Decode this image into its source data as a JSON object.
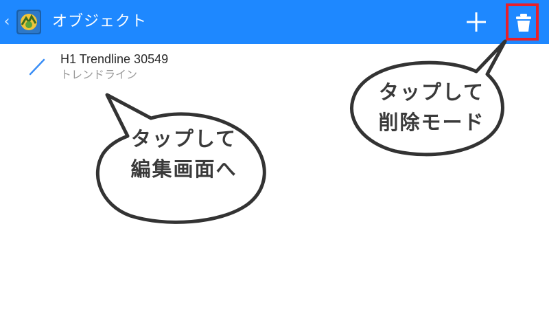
{
  "appbar": {
    "title": "オブジェクト",
    "background": "#1e88ff",
    "back_icon": "chevron-left-icon",
    "app_icon": "metatrader-app-icon",
    "add_icon": "plus-icon",
    "delete_icon": "trash-icon",
    "highlight_color": "#e8202a"
  },
  "objects": [
    {
      "title": "H1 Trendline 30549",
      "subtitle": "トレンドライン",
      "icon": "trendline-icon",
      "icon_color": "#3a8ef6"
    }
  ],
  "callouts": {
    "edit": {
      "line1": "タップして",
      "line2": "編集画面へ"
    },
    "delete": {
      "line1": "タップして",
      "line2": "削除モード"
    }
  }
}
